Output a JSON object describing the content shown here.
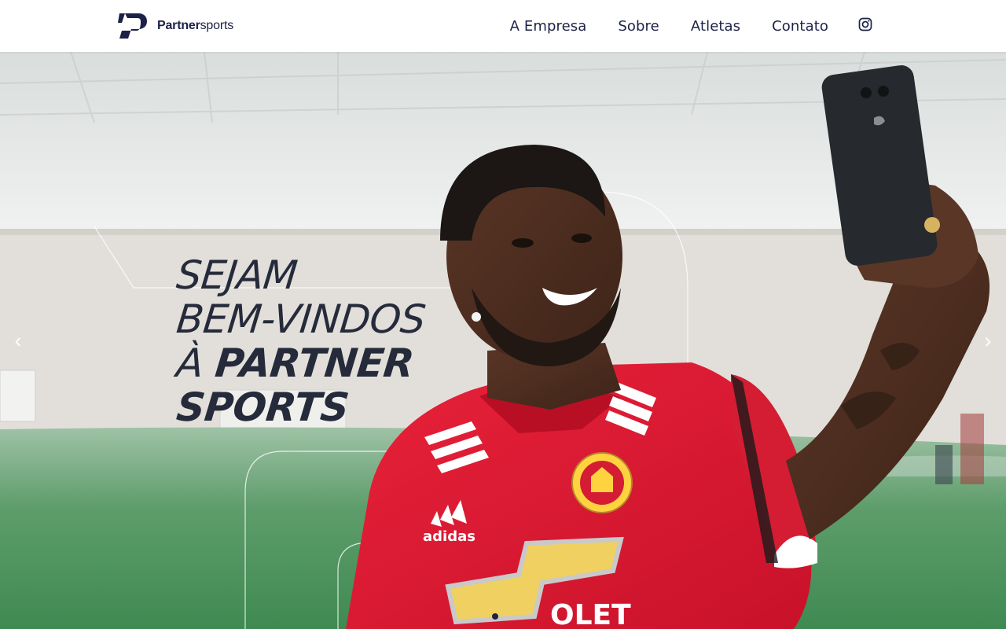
{
  "brand": {
    "name_bold": "Partner",
    "name_light": "sports"
  },
  "nav": {
    "items": [
      {
        "label": "A Empresa"
      },
      {
        "label": "Sobre"
      },
      {
        "label": "Atletas"
      },
      {
        "label": "Contato"
      }
    ],
    "social_icon": "instagram-icon"
  },
  "hero": {
    "title_line1": "SEJAM",
    "title_line2": "BEM-VINDOS",
    "title_line3_prefix": "À",
    "title_line3_bold": "PARTNER",
    "title_line4_bold": "SPORTS",
    "prev_label": "‹",
    "next_label": "›",
    "slide_count": 1,
    "active_slide": 1
  },
  "colors": {
    "brand_navy": "#1c2247",
    "title_text": "#262b3b",
    "jersey_red": "#d8192f",
    "pitch_green": "#3f8a52"
  }
}
